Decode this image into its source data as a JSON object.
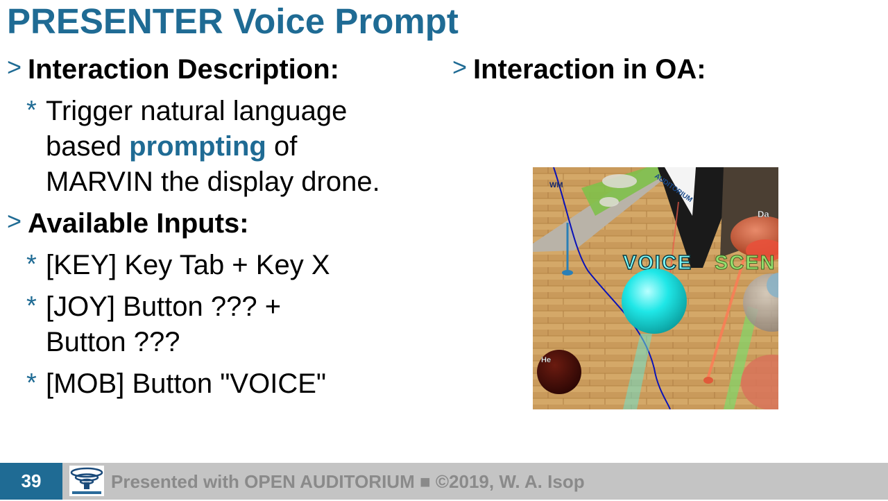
{
  "slide": {
    "title": "PRESENTER Voice Prompt",
    "left": {
      "heading1": {
        "marker": ">",
        "label": "Interaction Description:"
      },
      "desc": {
        "marker": "*",
        "line1": "Trigger natural language",
        "line2_pre": "based ",
        "line2_accent": "prompting",
        "line2_post": " of",
        "line3": "MARVIN the display drone."
      },
      "heading2": {
        "marker": ">",
        "label": "Available Inputs:"
      },
      "inputs": [
        {
          "marker": "*",
          "lines": [
            "[KEY] Key Tab + Key X"
          ]
        },
        {
          "marker": "*",
          "lines": [
            "[JOY] Button ??? +",
            "Button ???"
          ]
        },
        {
          "marker": "*",
          "lines": [
            "[MOB] Button \"VOICE\""
          ]
        }
      ]
    },
    "right": {
      "heading": {
        "marker": ">",
        "label": "Interaction in OA:"
      },
      "scene": {
        "voice_label": "VOICE",
        "scene_label": "SCEN",
        "signpost_text": "AUDITORIUM",
        "name_tag_1": "Da",
        "name_tag_2": "He",
        "name_tag_3": "WM"
      }
    }
  },
  "footer": {
    "page_number": "39",
    "text": "Presented with OPEN AUDITORIUM ■ ©2019, W. A. Isop"
  },
  "colors": {
    "accent": "#1f6b94",
    "footer_bg": "#c4c4c4",
    "footer_text": "#8a8a8a"
  }
}
